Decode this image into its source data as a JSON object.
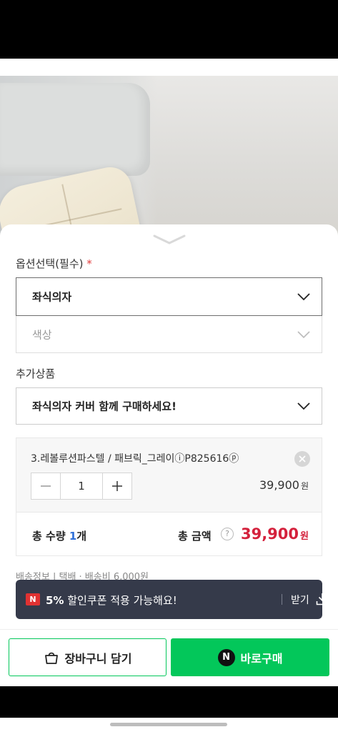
{
  "options": {
    "section_label": "옵션선택(필수)",
    "required_mark": "*",
    "primary_select": "좌식의자",
    "secondary_select_placeholder": "색상"
  },
  "addons": {
    "section_label": "추가상품",
    "select_text": "좌식의자 커버 함께 구매하세요!"
  },
  "selected_item": {
    "name": "3.레볼루션파스텔 / 패브릭_그레이ⓘP825616ⓟ",
    "quantity": "1",
    "price": "39,900",
    "price_unit": "원"
  },
  "totals": {
    "qty_label": "총 수량",
    "qty_value": "1",
    "qty_unit": "개",
    "price_label": "총 금액",
    "help_glyph": "?",
    "price_value": "39,900",
    "price_unit": "원"
  },
  "shipping": {
    "text": "배송정보 | 택배 · 배송비 6,000원"
  },
  "coupon": {
    "badge": "N",
    "percent": "5%",
    "message": "할인쿠폰 적용 가능해요!",
    "action": "받기"
  },
  "actions": {
    "cart_label": "장바구니 담기",
    "buy_badge": "N",
    "buy_label": "바로구매",
    "buy_color": "#03c75a"
  },
  "icons": {
    "collapse": "chevron-down-icon",
    "select_arrow": "chevron-down-icon",
    "remove": "close-icon",
    "minus": "minus-icon",
    "plus": "plus-icon",
    "download": "download-icon",
    "cart": "shopping-bag-icon"
  }
}
